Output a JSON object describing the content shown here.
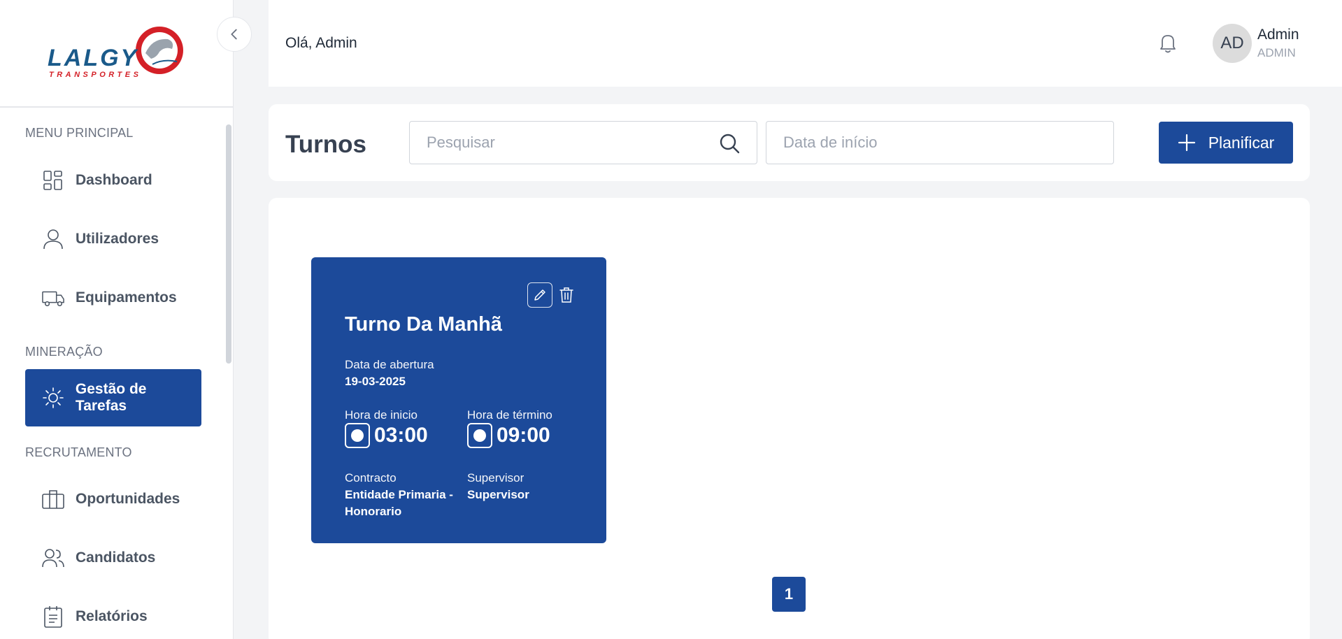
{
  "sidebar": {
    "logo": {
      "main": "LALGY",
      "sub": "TRANSPORTES"
    },
    "sections": [
      {
        "label": "MENU PRINCIPAL"
      },
      {
        "label": "MINERAÇÃO"
      },
      {
        "label": "RECRUTAMENTO"
      }
    ],
    "items": [
      {
        "label": "Dashboard",
        "icon": "dashboard-icon"
      },
      {
        "label": "Utilizadores",
        "icon": "user-icon"
      },
      {
        "label": "Equipamentos",
        "icon": "truck-icon"
      },
      {
        "label": "Gestão de Tarefas",
        "icon": "sun-icon",
        "active": true
      },
      {
        "label": "Oportunidades",
        "icon": "briefcase-icon"
      },
      {
        "label": "Candidatos",
        "icon": "users-icon"
      },
      {
        "label": "Relatórios",
        "icon": "report-icon"
      }
    ]
  },
  "header": {
    "greeting": "Olá, Admin",
    "user": {
      "initials": "AD",
      "name": "Admin",
      "role": "ADMIN"
    }
  },
  "toolbar": {
    "title": "Turnos",
    "search_placeholder": "Pesquisar",
    "date_placeholder": "Data de início",
    "plan_label": "Planificar"
  },
  "shifts": [
    {
      "title": "Turno Da Manhã",
      "opening_label": "Data de abertura",
      "opening_date": "19-03-2025",
      "start_label": "Hora de inicio",
      "start_time": "03:00",
      "end_label": "Hora de término",
      "end_time": "09:00",
      "contract_label": "Contracto",
      "contract_value": "Entidade Primaria - Honorario",
      "supervisor_label": "Supervisor",
      "supervisor_value": "Supervisor"
    }
  ],
  "pagination": {
    "current": "1"
  },
  "colors": {
    "primary": "#1c4a9a",
    "background": "#f3f4f6",
    "logo_red": "#d42027",
    "logo_blue": "#1a5a8a"
  }
}
